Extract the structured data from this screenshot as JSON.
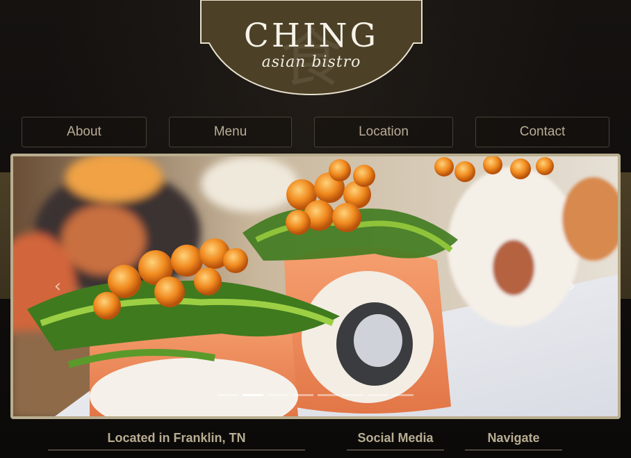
{
  "logo": {
    "title": "CHING",
    "subtitle": "asian bistro"
  },
  "nav": {
    "items": [
      {
        "label": "About"
      },
      {
        "label": "Menu"
      },
      {
        "label": "Location"
      },
      {
        "label": "Contact"
      }
    ]
  },
  "slider": {
    "prev_icon": "chevron-left-icon",
    "next_icon": "chevron-right-icon",
    "prev_glyph": "‹",
    "next_glyph": "›",
    "slide_count": 8,
    "active_slide": 2
  },
  "footer": {
    "location_heading": "Located in Franklin, TN",
    "social_heading": "Social Media",
    "navigate_heading": "Navigate"
  },
  "colors": {
    "background": "#0f0c0a",
    "band": "#4b3f26",
    "logo_plate": "#4c4127",
    "slider_border": "#b9ae8f",
    "nav_text": "#b9ad97",
    "footer_text": "#b8ad92"
  }
}
